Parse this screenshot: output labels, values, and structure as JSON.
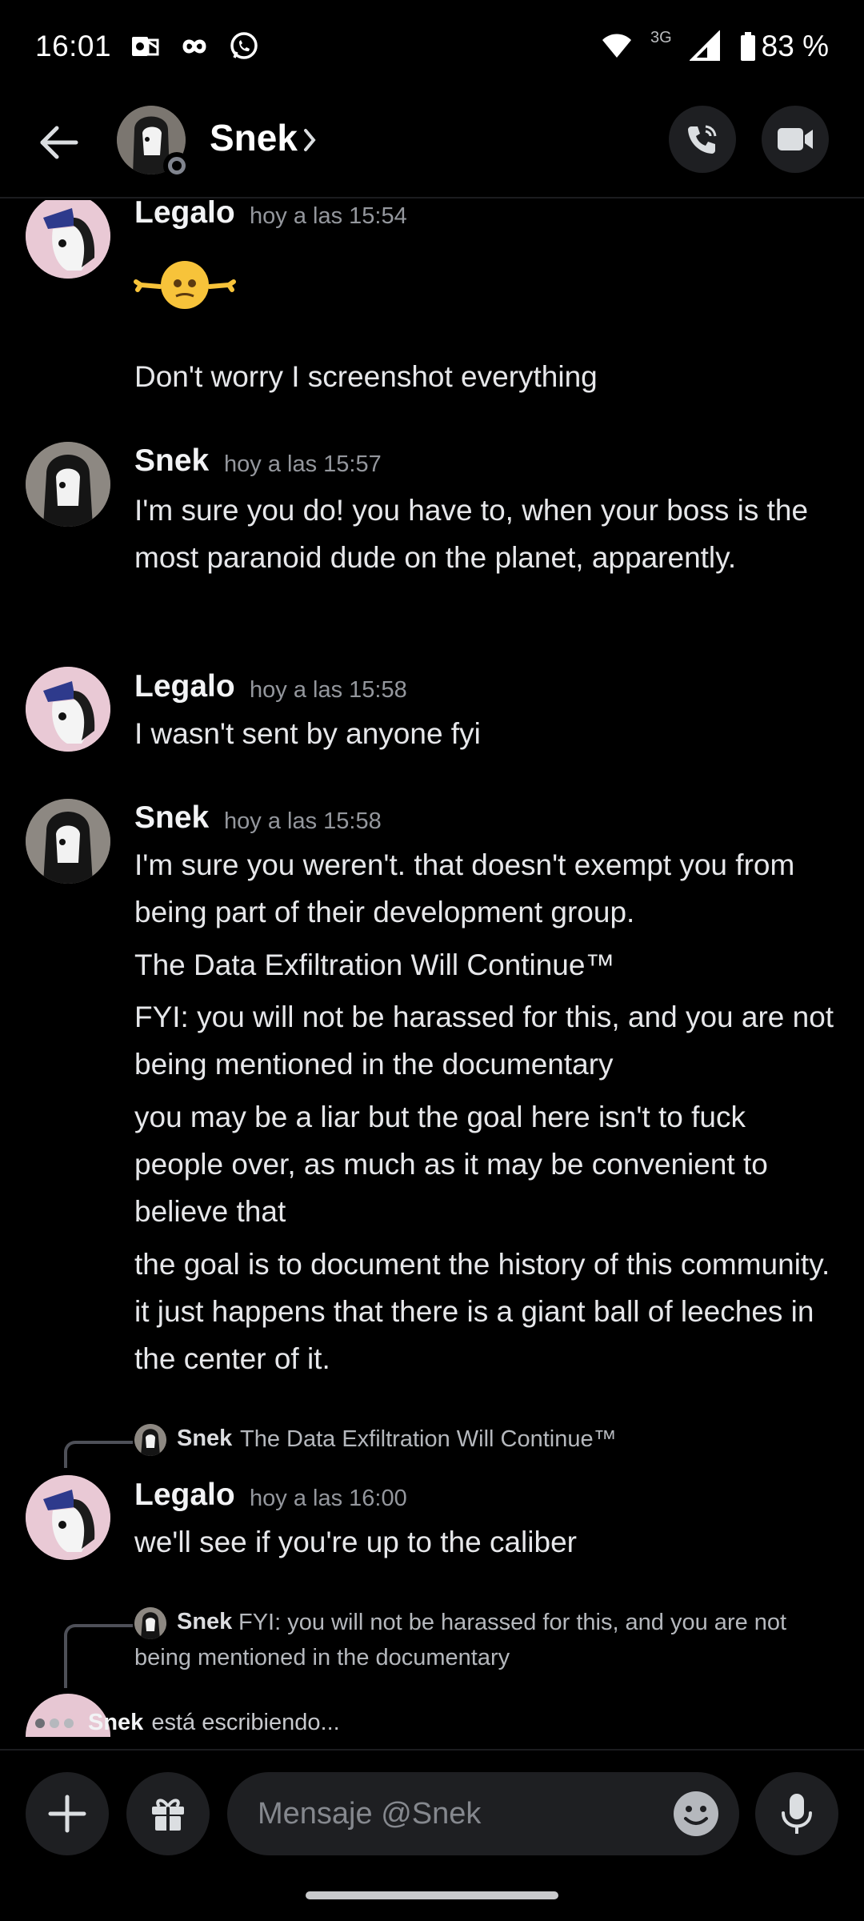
{
  "status_bar": {
    "time": "16:01",
    "network": "3G",
    "battery": "83 %"
  },
  "header": {
    "name": "Snek"
  },
  "messages": [
    {
      "author": "Legalo",
      "timestamp": "hoy a las 15:54",
      "lines": [
        "Don't worry I screenshot everything"
      ],
      "emoji": "shrugging-smiley-emoji"
    },
    {
      "author": "Snek",
      "timestamp": "hoy a las 15:57",
      "lines": [
        "I'm sure you do! you have to, when your boss is the most paranoid dude on the planet, apparently."
      ]
    },
    {
      "author": "Legalo",
      "timestamp": "hoy a las 15:58",
      "lines": [
        "I wasn't sent by anyone fyi"
      ]
    },
    {
      "author": "Snek",
      "timestamp": "hoy a las 15:58",
      "lines": [
        "I'm sure you weren't. that doesn't exempt you from being part of their development group.",
        "The Data Exfiltration Will Continue™",
        "FYI: you will not be harassed for this, and you are not being mentioned in the documentary",
        "you may be a liar but the goal here isn't to fuck people over, as much as it may be convenient to believe that",
        "the goal is to document the history of this community.  it just happens that there is a giant ball of leeches in the center of it."
      ]
    },
    {
      "reply_to_author": "Snek",
      "reply_to_text": "The Data Exfiltration Will Continue™",
      "author": "Legalo",
      "timestamp": "hoy a las 16:00",
      "lines": [
        "we'll see if you're up to the caliber"
      ]
    },
    {
      "reply_to_author": "Snek",
      "reply_to_text": "FYI: you will not be harassed for this, and you are not being mentioned in the documentary"
    }
  ],
  "typing": {
    "name": "Snek",
    "text": "está escribiendo..."
  },
  "composer": {
    "placeholder": "Mensaje @Snek"
  },
  "colors": {
    "background": "#000000",
    "surface": "#1e1f22",
    "timestamp": "#94979d"
  }
}
